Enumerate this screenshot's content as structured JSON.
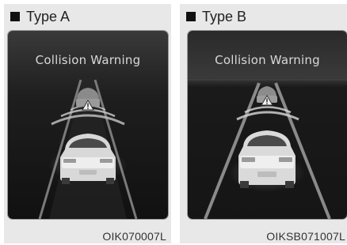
{
  "panels": [
    {
      "type_label": "Type A",
      "warning_text": "Collision Warning",
      "image_code": "OIK070007L"
    },
    {
      "type_label": "Type B",
      "warning_text": "Collision Warning",
      "image_code": "OIKSB071007L"
    }
  ]
}
